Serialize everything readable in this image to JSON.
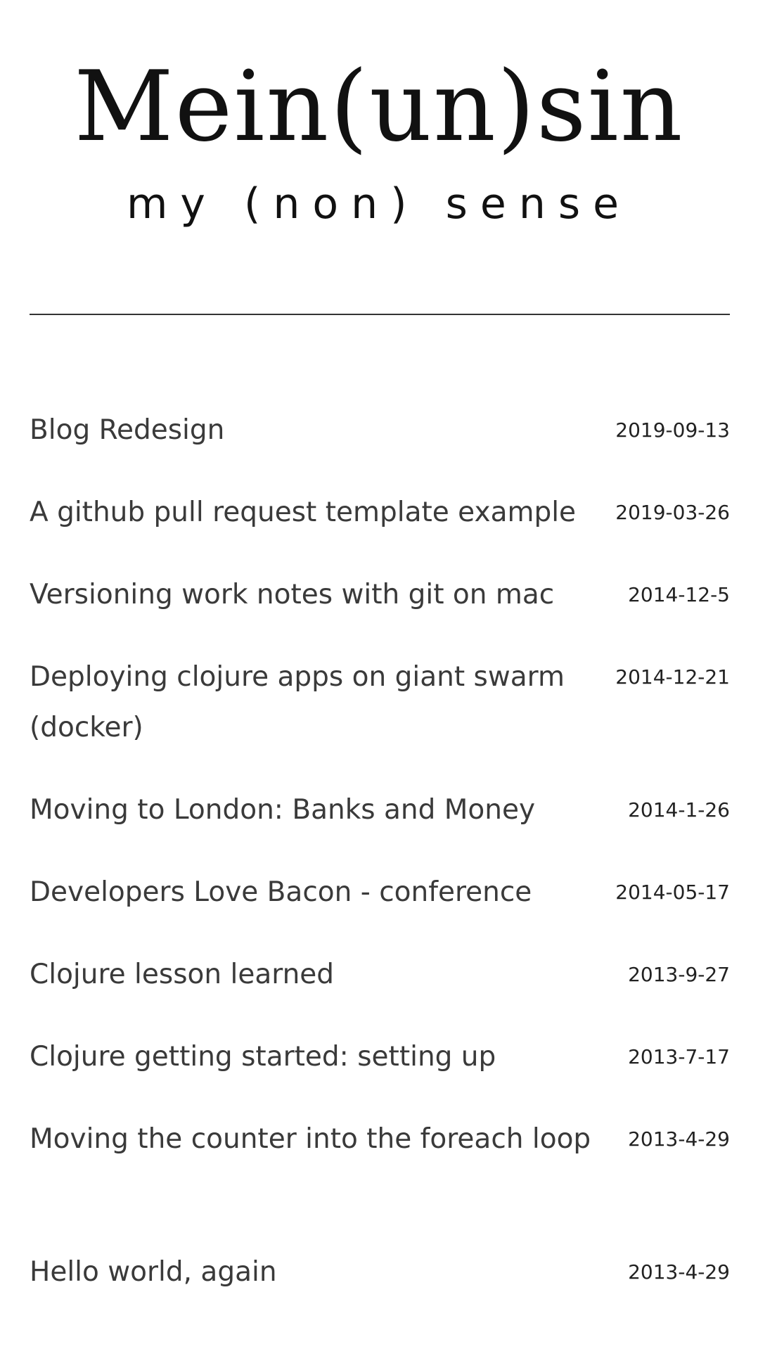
{
  "site": {
    "title": "Mein(un)sin",
    "subtitle": "my (non) sense"
  },
  "posts": [
    {
      "title": "Blog Redesign",
      "date": "2019-09-13"
    },
    {
      "title": "A github pull request template example",
      "date": "2019-03-26"
    },
    {
      "title": "Versioning work notes with git on mac",
      "date": "2014-12-5"
    },
    {
      "title": "Deploying clojure apps on giant swarm (docker)",
      "date": "2014-12-21"
    },
    {
      "title": "Moving to London: Banks and Money",
      "date": "2014-1-26"
    },
    {
      "title": "Developers Love Bacon - conference",
      "date": "2014-05-17"
    },
    {
      "title": "Clojure lesson learned",
      "date": "2013-9-27"
    },
    {
      "title": "Clojure getting started: setting up",
      "date": "2013-7-17"
    },
    {
      "title": "Moving the counter into the foreach loop",
      "date": "2013-4-29"
    },
    {
      "title": "Hello world, again",
      "date": "2013-4-29"
    }
  ]
}
